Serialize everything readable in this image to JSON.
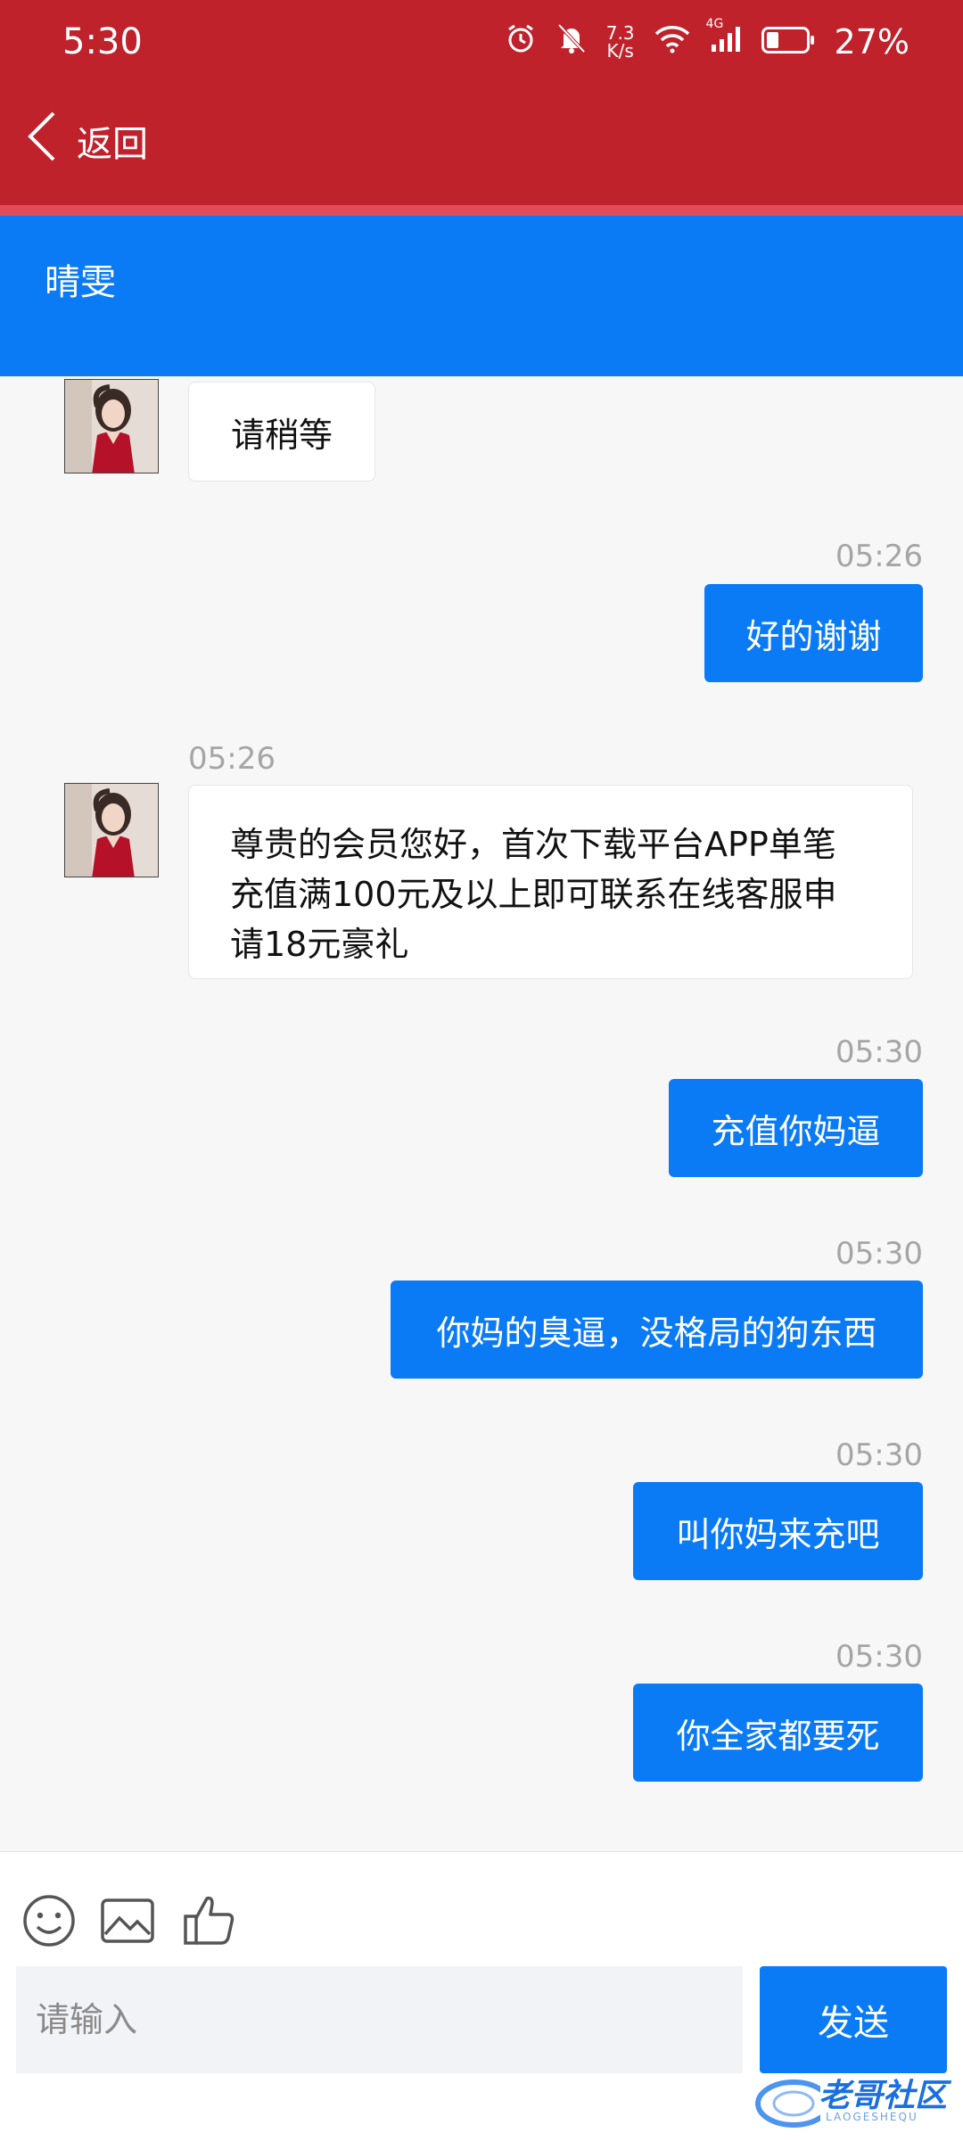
{
  "status_bar": {
    "time": "5:30",
    "net_speed_value": "7.3",
    "net_speed_unit": "K/s",
    "network": "4G",
    "battery": "27%"
  },
  "nav": {
    "back_label": "返回"
  },
  "chat": {
    "contact_name": "晴雯"
  },
  "messages": [
    {
      "side": "left",
      "text": "请稍等",
      "time": ""
    },
    {
      "side": "right",
      "text": "好的谢谢",
      "time": "05:26"
    },
    {
      "side": "left",
      "text_lines": [
        "尊贵的会员您好，首次下载平台APP单笔",
        "充值满100元及以上即可联系在线客服申",
        "请18元豪礼"
      ],
      "time": "05:26"
    },
    {
      "side": "right",
      "text": "充值你妈逼",
      "time": "05:30"
    },
    {
      "side": "right",
      "text": "你妈的臭逼，没格局的狗东西",
      "time": "05:30"
    },
    {
      "side": "right",
      "text": "叫你妈来充吧",
      "time": "05:30"
    },
    {
      "side": "right",
      "text": "你全家都要死",
      "time": "05:30"
    }
  ],
  "input": {
    "placeholder": "请输入",
    "send_label": "发送"
  },
  "watermark": {
    "text": "老哥社区",
    "sub": "LAOGESHEQU"
  },
  "colors": {
    "header_red": "#c0222c",
    "title_blue": "#0a7bf5",
    "bubble_blue": "#0a7bf5"
  }
}
